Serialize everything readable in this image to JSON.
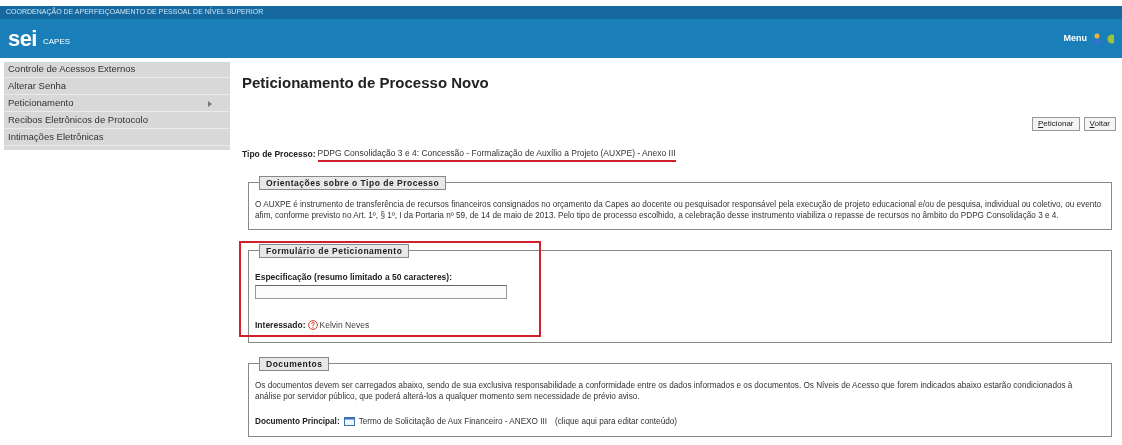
{
  "header": {
    "organization": "COORDENAÇÃO DE APERFEIÇOAMENTO DE PESSOAL DE NÍVEL SUPERIOR",
    "logo": "sei",
    "logo_subtitle": "CAPES",
    "menu": "Menu"
  },
  "sidebar": {
    "items": [
      {
        "label": "Controle de Acessos Externos",
        "has_submenu": false
      },
      {
        "label": "Alterar Senha",
        "has_submenu": false
      },
      {
        "label": "Peticionamento",
        "has_submenu": true
      },
      {
        "label": "Recibos Eletrônicos de Protocolo",
        "has_submenu": false
      },
      {
        "label": "Intimações Eletrônicas",
        "has_submenu": false
      }
    ]
  },
  "page_title": "Peticionamento de Processo Novo",
  "buttons": [
    "Peticionar",
    "Voltar"
  ],
  "process_type": {
    "label": "Tipo de Processo:",
    "value": "PDPG Consolidação 3 e 4: Concessão - Formalização de Auxílio a Projeto (AUXPE) - Anexo III"
  },
  "guidance": {
    "legend": "Orientações sobre o Tipo de Processo",
    "text": "O AUXPE é instrumento de transferência de recursos financeiros consignados no orçamento da Capes ao docente ou pesquisador responsável pela execução de projeto educacional e/ou de pesquisa, individual ou coletivo, ou evento afim, conforme previsto no Art. 1º, § 1º, I da Portaria nº 59, de 14 de maio de 2013. Pelo tipo de processo escolhido, a celebração desse instrumento viabiliza o repasse de recursos no âmbito do PDPG Consolidação 3 e 4."
  },
  "form": {
    "legend": "Formulário de Peticionamento",
    "specification_label": "Especificação (resumo limitado a 50 caracteres):",
    "interested_label": "Interessado:",
    "interested_value": "Kelvin Neves"
  },
  "documents": {
    "legend": "Documentos",
    "text": "Os documentos devem ser carregados abaixo, sendo de sua exclusiva responsabilidade a conformidade entre os dados informados e os documentos. Os Níveis de Acesso que forem indicados abaixo estarão condicionados à análise por servidor público, que poderá alterá-los a qualquer momento sem necessidade de prévio aviso.",
    "main_label": "Documento Principal:",
    "main_value": "Termo de Solicitação de Aux Financeiro - ANEXO III",
    "main_hint": "(clique aqui para editar conteúdo)"
  }
}
